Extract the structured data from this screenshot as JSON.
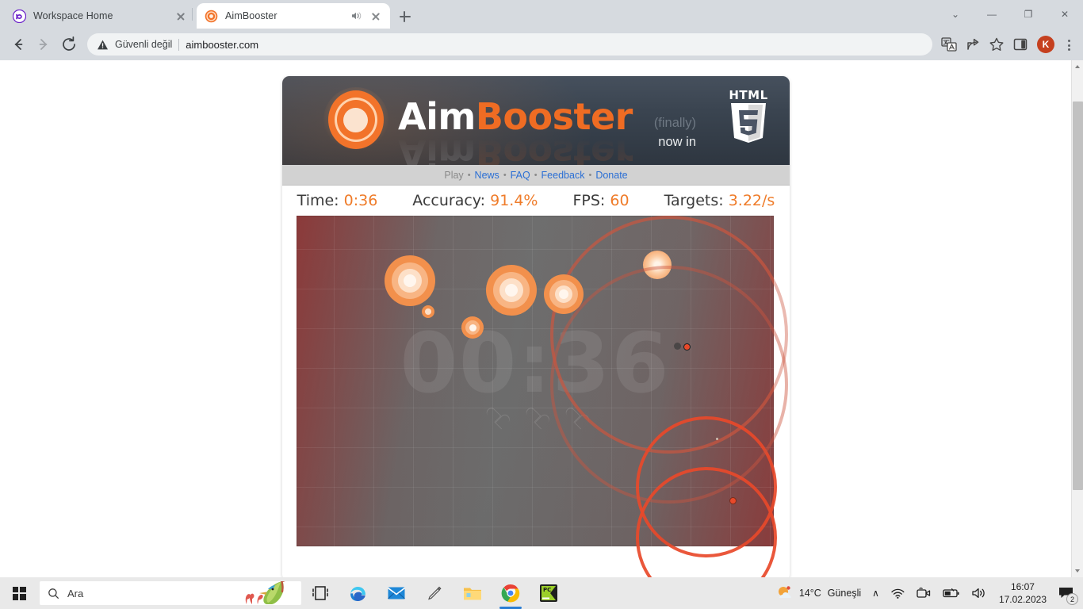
{
  "browser": {
    "tabs": [
      {
        "title": "Workspace Home",
        "favicon": "workspace-icon",
        "active": false,
        "audio": false
      },
      {
        "title": "AimBooster",
        "favicon": "aimbooster-icon",
        "active": true,
        "audio": true
      }
    ],
    "new_tab_label": "+",
    "window_controls": {
      "minimize": "—",
      "maximize": "❐",
      "close": "✕",
      "tab_search": "⌄"
    },
    "nav": {
      "back": "←",
      "forward": "→",
      "reload": "⟳"
    },
    "omnibox": {
      "security_label": "Güvenli değil",
      "url": "aimbooster.com",
      "security_icon": "warning-triangle-icon"
    },
    "toolbar_icons": [
      "translate-icon",
      "share-icon",
      "bookmark-star-icon",
      "side-panel-icon"
    ],
    "profile_initial": "K"
  },
  "site": {
    "logo": {
      "word1": "Aim",
      "word2": "Booster"
    },
    "html5_badge": {
      "top_text": "HTML",
      "number": "5"
    },
    "tagline_line1": "(finally)",
    "tagline_line2": "now in",
    "nav": [
      {
        "label": "Play",
        "current": true
      },
      {
        "label": "News",
        "current": false
      },
      {
        "label": "FAQ",
        "current": false
      },
      {
        "label": "Feedback",
        "current": false
      },
      {
        "label": "Donate",
        "current": false
      }
    ],
    "separator": "•",
    "stats": [
      {
        "label": "Time:",
        "value": "0:36"
      },
      {
        "label": "Accuracy:",
        "value": "91.4%"
      },
      {
        "label": "FPS:",
        "value": "60"
      },
      {
        "label": "Targets:",
        "value": "3.22/s"
      }
    ],
    "stage": {
      "clock_overlay": "00:36",
      "lives": 3,
      "accent_target": "#f2904c",
      "accent_ring": "#e8492a"
    }
  },
  "taskbar": {
    "start_label": "start-button",
    "search_placeholder": "Ara",
    "apps": [
      "task-view-icon",
      "edge-icon",
      "mail-icon",
      "snip-icon",
      "file-explorer-icon",
      "chrome-icon",
      "pycharm-icon"
    ],
    "tray": {
      "weather_temp": "14°C",
      "weather_desc": "Güneşli",
      "chevron": "∧",
      "icons": [
        "wifi-icon",
        "meet-now-icon",
        "battery-icon",
        "volume-icon"
      ],
      "time": "16:07",
      "date": "17.02.2023",
      "notification_count": "2"
    }
  }
}
